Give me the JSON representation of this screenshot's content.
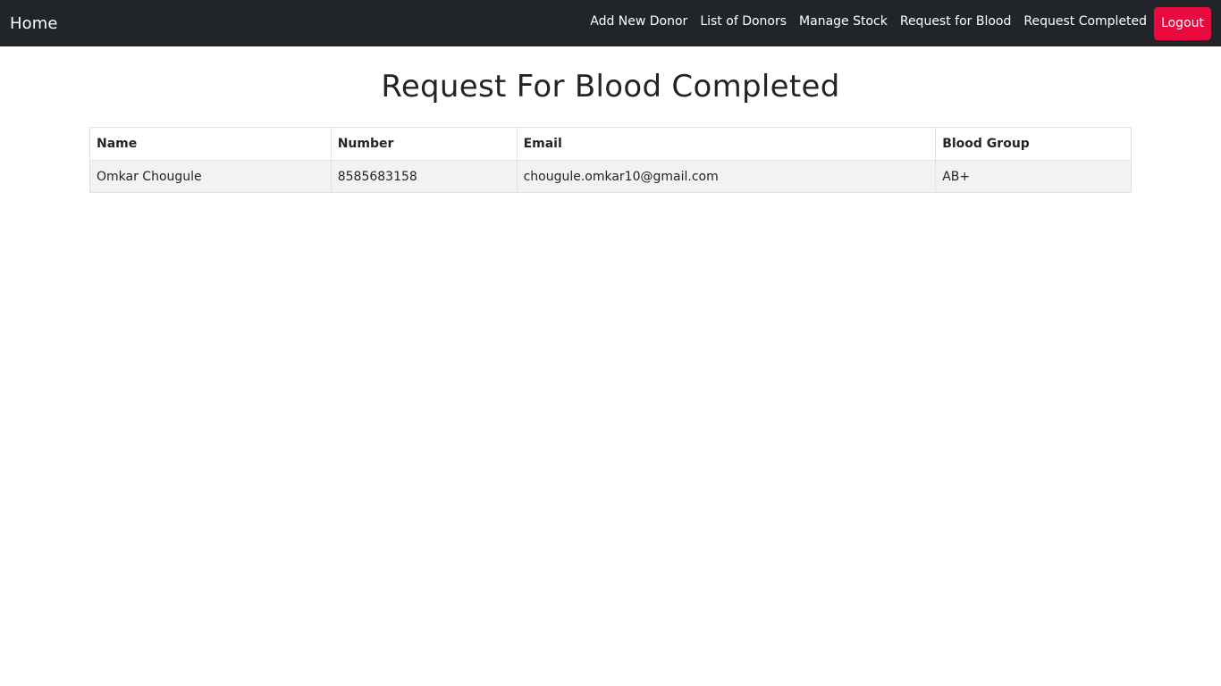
{
  "navbar": {
    "brand": "Home",
    "links": [
      {
        "label": "Add New Donor"
      },
      {
        "label": "List of Donors"
      },
      {
        "label": "Manage Stock"
      },
      {
        "label": "Request for Blood"
      },
      {
        "label": "Request Completed"
      }
    ],
    "logout_label": "Logout"
  },
  "main": {
    "title": "Request For Blood Completed",
    "table": {
      "columns": [
        "Name",
        "Number",
        "Email",
        "Blood Group"
      ],
      "rows": [
        [
          "Omkar Chougule",
          "8585683158",
          "chougule.omkar10@gmail.com",
          "AB+"
        ]
      ]
    }
  },
  "colors": {
    "navbar_bg": "#212529",
    "logout_bg": "#e8093f",
    "row_bg": "#f2f2f2"
  }
}
